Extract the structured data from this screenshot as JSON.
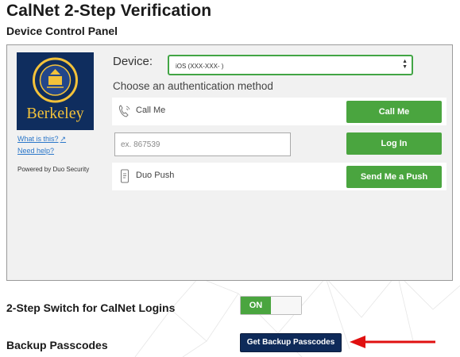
{
  "page": {
    "title": "CalNet 2-Step Verification"
  },
  "panel": {
    "title": "Device Control Panel",
    "logo_text": "Berkeley",
    "what_is_this": "What is this?",
    "need_help": "Need help?",
    "powered_by": "Powered by Duo Security",
    "device_label": "Device:",
    "device_selected": "iOS (XXX-XXX-        )",
    "choose_label": "Choose an authentication method",
    "methods": [
      {
        "label": "Call Me",
        "icon": "phone-icon",
        "button": "Call Me"
      },
      {
        "placeholder": "ex. 867539",
        "button": "Log In"
      },
      {
        "label": "Duo Push",
        "icon": "mobile-icon",
        "button": "Send Me a Push"
      }
    ]
  },
  "switch_row": {
    "label": "2-Step Switch for CalNet Logins",
    "state": "ON"
  },
  "backup_row": {
    "label": "Backup Passcodes",
    "button": "Get Backup Passcodes"
  },
  "colors": {
    "accent_green": "#4aa53f",
    "navy": "#0e2a59",
    "arrow_red": "#e01010"
  }
}
